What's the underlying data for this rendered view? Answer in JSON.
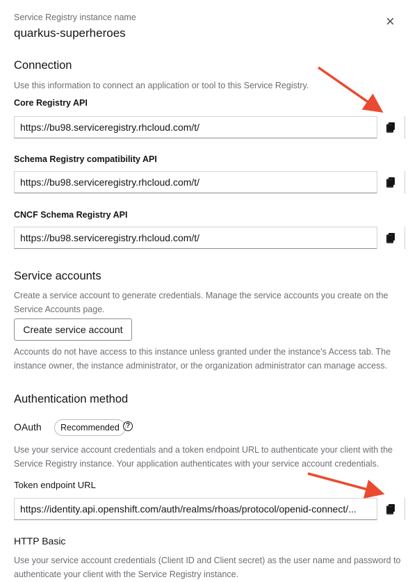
{
  "header": {
    "subtitle": "Service Registry instance name",
    "title": "quarkus-superheroes",
    "close_glyph": "×"
  },
  "connection": {
    "heading": "Connection",
    "description": "Use this information to connect an application or tool to this Service Registry.",
    "fields": [
      {
        "label": "Core Registry API",
        "value": "https://bu98.serviceregistry.rhcloud.com/t/",
        "trail": "."
      },
      {
        "label": "Schema Registry compatibility API",
        "value": "https://bu98.serviceregistry.rhcloud.com/t/",
        "trail": "."
      },
      {
        "label": "CNCF Schema Registry API",
        "value": "https://bu98.serviceregistry.rhcloud.com/t/",
        "trail": "."
      }
    ]
  },
  "service_accounts": {
    "heading": "Service accounts",
    "description": "Create a service account to generate credentials. Manage the service accounts you create on the Service Accounts page.",
    "button_label": "Create service account",
    "note": "Accounts do not have access to this instance unless granted under the instance's Access tab. The instance owner, the instance administrator, or the organization administrator can manage access."
  },
  "authentication": {
    "heading": "Authentication method",
    "oauth_label": "OAuth",
    "oauth_badge": "Recommended",
    "help_glyph": "?",
    "oauth_description": "Use your service account credentials and a token endpoint URL to authenticate your client with the Service Registry instance. Your application authenticates with your service account credentials.",
    "token_label": "Token endpoint URL",
    "token_value": "https://identity.api.openshift.com/auth/realms/rhoas/protocol/openid-connect/...",
    "basic_heading": "HTTP Basic",
    "basic_description": "Use your service account credentials (Client ID and Client secret) as the user name and password to authenticate your client with the Service Registry instance."
  },
  "icons": {
    "copy": "copy-icon",
    "close": "close-icon",
    "help": "help-icon",
    "arrow": "red-arrow-annotation"
  },
  "colors": {
    "arrow": "#ea4a2f",
    "muted_text": "#6a6e73",
    "border": "#d2d2d2"
  }
}
